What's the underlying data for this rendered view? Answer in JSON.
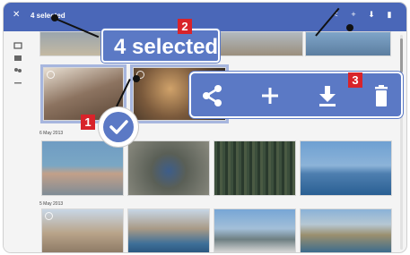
{
  "app_bar": {
    "close_icon": "close-icon",
    "title": "4 selected",
    "actions": [
      {
        "name": "share-icon"
      },
      {
        "name": "add-icon"
      },
      {
        "name": "download-icon"
      },
      {
        "name": "delete-icon"
      }
    ]
  },
  "rail": {
    "items": [
      "photos-icon",
      "albums-icon",
      "people-icon",
      "more-icon"
    ]
  },
  "sections": [
    {
      "date": ""
    },
    {
      "date": "6 May 2013"
    },
    {
      "date": "5 May 2013"
    }
  ],
  "callouts": {
    "selected_text": "4 selected",
    "badges": [
      "1",
      "2",
      "3"
    ]
  },
  "colors": {
    "app_bar": "#4a67b8",
    "callout_fill": "#5b79c5",
    "badge": "#d8232a"
  }
}
